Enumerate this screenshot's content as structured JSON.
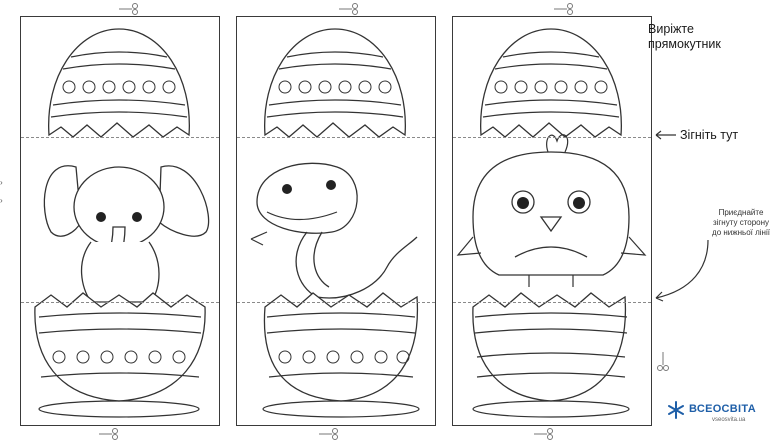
{
  "instructions": {
    "cut": "Виріжте прямокутник",
    "fold": "Зігніть тут",
    "attach": "Приєднайте зігнуту сторону до нижньої лінії"
  },
  "cards": [
    {
      "animal": "elephant"
    },
    {
      "animal": "snake"
    },
    {
      "animal": "chick"
    }
  ],
  "logo": {
    "name": "ВСЕОСВІТА",
    "url": "vseosvita.ua",
    "color": "#1f5fa8"
  },
  "icons": [
    "scissors-icon",
    "arrow-icon",
    "snowflake-icon"
  ]
}
